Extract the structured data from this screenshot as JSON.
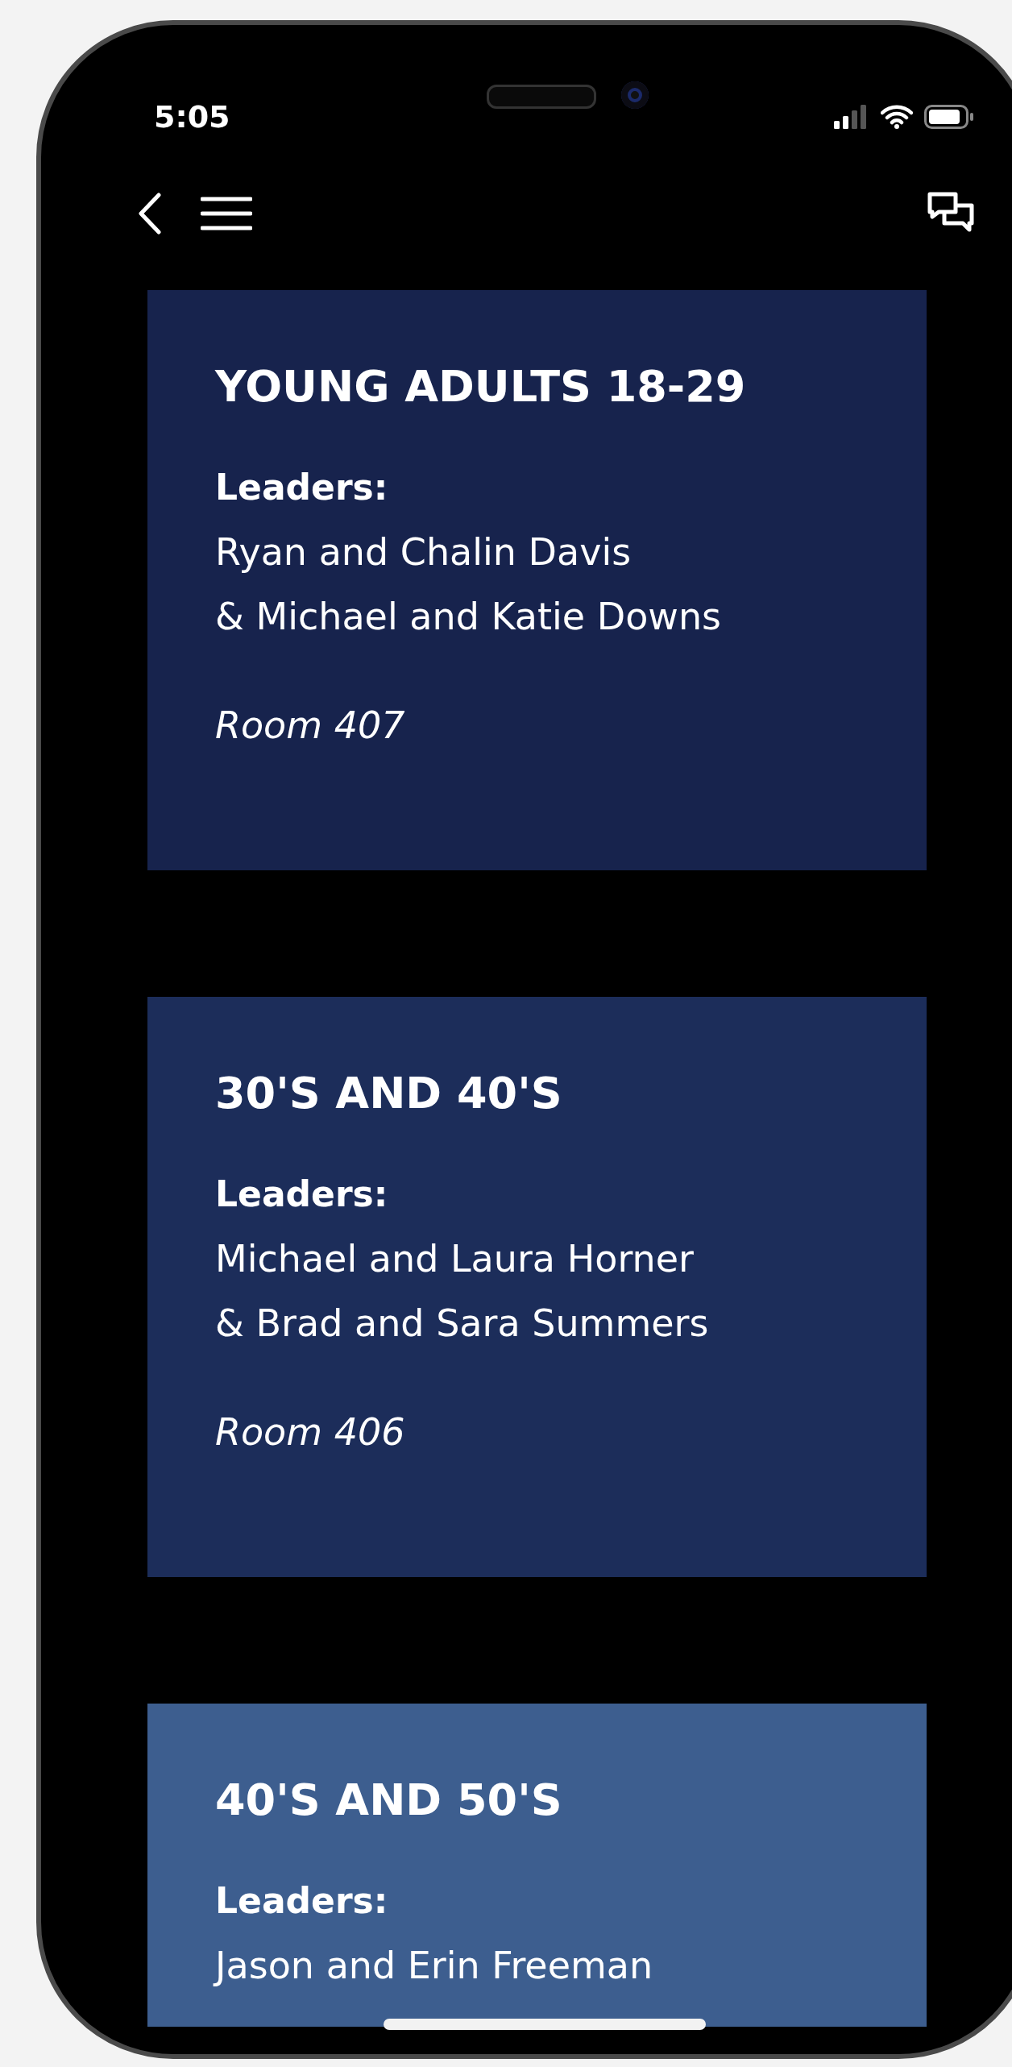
{
  "status_bar": {
    "time": "5:05"
  },
  "groups": [
    {
      "title": "YOUNG ADULTS 18-29",
      "leaders_label": "Leaders:",
      "leaders": [
        "Ryan and Chalin Davis",
        "& Michael and Katie Downs"
      ],
      "room": "Room 407",
      "color": "#17234d"
    },
    {
      "title": "30'S AND 40'S",
      "leaders_label": "Leaders:",
      "leaders": [
        "Michael and Laura Horner",
        "& Brad and Sara Summers"
      ],
      "room": "Room 406",
      "color": "#1c2d5a"
    },
    {
      "title": "40'S AND 50'S",
      "leaders_label": "Leaders:",
      "leaders": [
        "Jason and Erin Freeman"
      ],
      "color": "#3d5e8f"
    }
  ]
}
